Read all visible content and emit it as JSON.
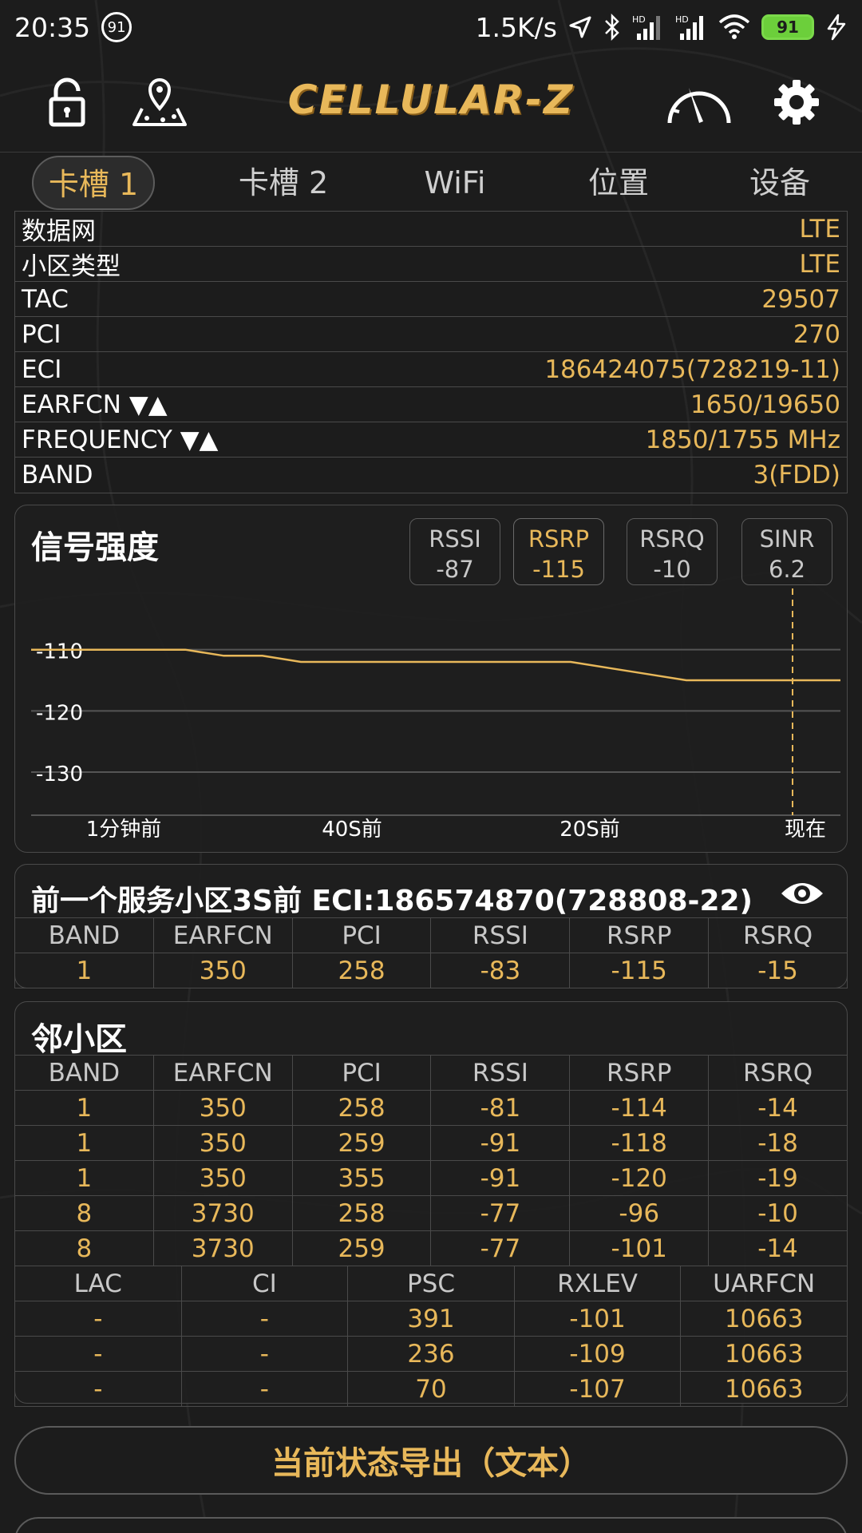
{
  "status_bar": {
    "time": "20:35",
    "notification_count": "91",
    "net_speed": "1.5K/s",
    "battery": "91"
  },
  "app": {
    "logo_text": "CELLULAR-Z"
  },
  "tabs": [
    "卡槽 1",
    "卡槽 2",
    "WiFi",
    "位置",
    "设备"
  ],
  "info_rows": [
    {
      "label": "数据网",
      "value": "LTE"
    },
    {
      "label": "小区类型",
      "value": "LTE"
    },
    {
      "label": "TAC",
      "value": "29507"
    },
    {
      "label": "PCI",
      "value": "270"
    },
    {
      "label": "ECI",
      "value": "186424075(728219-11)"
    },
    {
      "label": "EARFCN ▼▲",
      "value": "1650/19650"
    },
    {
      "label": "FREQUENCY ▼▲",
      "value": "1850/1755 MHz"
    },
    {
      "label": "BAND",
      "value": "3(FDD)"
    }
  ],
  "signal": {
    "title": "信号强度",
    "metrics": [
      {
        "name": "RSSI",
        "value": "-87"
      },
      {
        "name": "RSRP",
        "value": "-115"
      },
      {
        "name": "RSRQ",
        "value": "-10"
      },
      {
        "name": "SINR",
        "value": "6.2"
      }
    ]
  },
  "chart_data": {
    "type": "line",
    "series": [
      {
        "values": [
          -110,
          -110,
          -110,
          -110,
          -110,
          -111,
          -111,
          -112,
          -112,
          -112,
          -112,
          -112,
          -112,
          -112,
          -112,
          -113,
          -114,
          -115,
          -115,
          -115,
          -115,
          -115
        ]
      }
    ],
    "y_ticks": [
      -110,
      -120,
      -130
    ],
    "x_tick_labels": [
      "1分钟前",
      "40S前",
      "20S前",
      "现在"
    ],
    "ylim": [
      -136,
      -106
    ],
    "accent": "#e8b85a"
  },
  "previous_cell": {
    "title": "前一个服务小区3S前 ECI:186574870(728808-22)",
    "headers": [
      "BAND",
      "EARFCN",
      "PCI",
      "RSSI",
      "RSRP",
      "RSRQ"
    ],
    "rows": [
      [
        "1",
        "350",
        "258",
        "-83",
        "-115",
        "-15"
      ]
    ]
  },
  "neighbors": {
    "title": "邻小区",
    "headers": [
      "BAND",
      "EARFCN",
      "PCI",
      "RSSI",
      "RSRP",
      "RSRQ"
    ],
    "rows": [
      [
        "1",
        "350",
        "258",
        "-81",
        "-114",
        "-14"
      ],
      [
        "1",
        "350",
        "259",
        "-91",
        "-118",
        "-18"
      ],
      [
        "1",
        "350",
        "355",
        "-91",
        "-120",
        "-19"
      ],
      [
        "8",
        "3730",
        "258",
        "-77",
        "-96",
        "-10"
      ],
      [
        "8",
        "3730",
        "259",
        "-77",
        "-101",
        "-14"
      ]
    ],
    "umts_headers": [
      "LAC",
      "CI",
      "PSC",
      "RXLEV",
      "UARFCN"
    ],
    "umts_rows": [
      [
        "-",
        "-",
        "391",
        "-101",
        "10663"
      ],
      [
        "-",
        "-",
        "236",
        "-109",
        "10663"
      ],
      [
        "-",
        "-",
        "70",
        "-107",
        "10663"
      ]
    ]
  },
  "export_button": "当前状态导出（文本）",
  "colors": {
    "accent": "#e8b85a",
    "background": "#1c1c1c",
    "border": "#4a4a4a"
  }
}
